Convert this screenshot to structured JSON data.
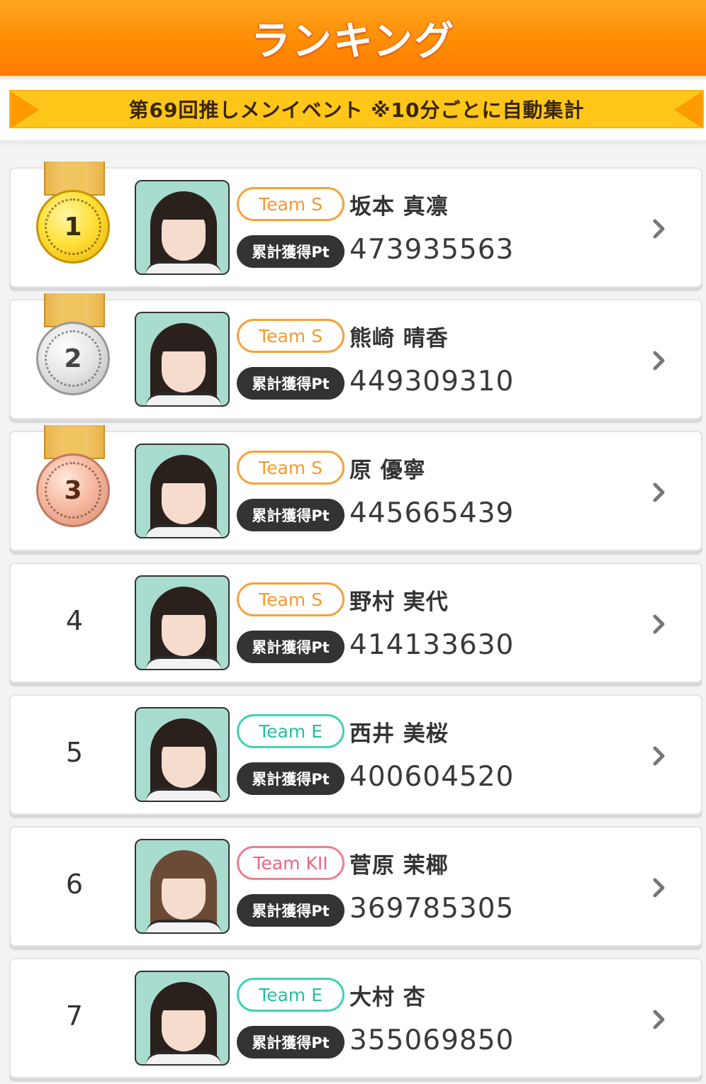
{
  "header": {
    "title": "ランキング"
  },
  "banner": {
    "text": "第69回推しメンイベント ※10分ごとに自動集計"
  },
  "pt_label": "累計獲得Pt",
  "ranking": [
    {
      "rank": "1",
      "team": "Team S",
      "team_color": "#f39a2e",
      "name": "坂本 真凛",
      "points": "473935563",
      "medal": "gold"
    },
    {
      "rank": "2",
      "team": "Team S",
      "team_color": "#f39a2e",
      "name": "熊崎 晴香",
      "points": "449309310",
      "medal": "silver"
    },
    {
      "rank": "3",
      "team": "Team S",
      "team_color": "#f39a2e",
      "name": "原 優寧",
      "points": "445665439",
      "medal": "bronze"
    },
    {
      "rank": "4",
      "team": "Team S",
      "team_color": "#f39a2e",
      "name": "野村 実代",
      "points": "414133630",
      "medal": ""
    },
    {
      "rank": "5",
      "team": "Team E",
      "team_color": "#27bf9f",
      "name": "西井 美桜",
      "points": "400604520",
      "medal": ""
    },
    {
      "rank": "6",
      "team": "Team KII",
      "team_color": "#ea6680",
      "name": "菅原 茉椰",
      "points": "369785305",
      "medal": ""
    },
    {
      "rank": "7",
      "team": "Team E",
      "team_color": "#27bf9f",
      "name": "大村 杏",
      "points": "355069850",
      "medal": ""
    }
  ]
}
